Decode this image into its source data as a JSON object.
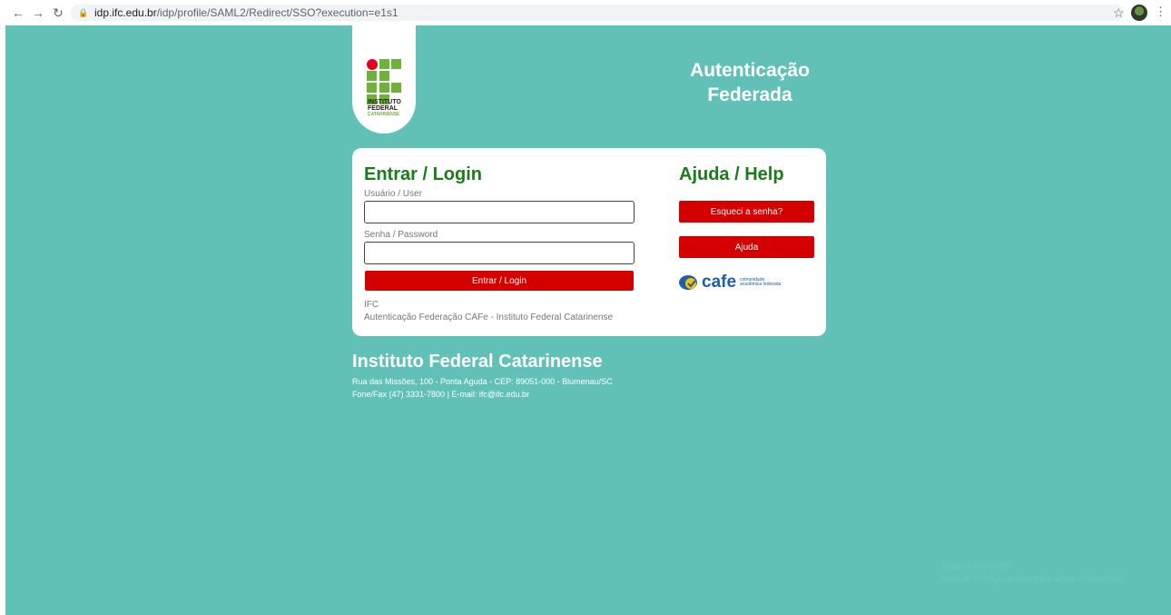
{
  "browser": {
    "url_host": "idp.ifc.edu.br",
    "url_path": "/idp/profile/SAML2/Redirect/SSO?execution=e1s1"
  },
  "logo": {
    "line1": "INSTITUTO",
    "line2": "FEDERAL",
    "line3": "CATARINENSE"
  },
  "header": {
    "title_line1": "Autenticação",
    "title_line2": "Federada"
  },
  "login": {
    "heading": "Entrar / Login",
    "user_label": "Usuário / User",
    "password_label": "Senha / Password",
    "user_value": "",
    "password_value": "",
    "submit_label": "Entrar / Login",
    "footer_line1": "IFC",
    "footer_line2": "Autenticação Federação CAFe - Instituto Federal Catarinense"
  },
  "help": {
    "heading": "Ajuda / Help",
    "forgot_label": "Esqueci a senha?",
    "help_label": "Ajuda",
    "cafe_word": "cafe",
    "cafe_tag_line1": "comunidade",
    "cafe_tag_line2": "acadêmica federada"
  },
  "institution": {
    "name": "Instituto Federal Catarinense",
    "address": "Rua das Missões, 100 - Ponta Aguda - CEP: 89051-000 - Blumenau/SC",
    "contact": "Fone/Fax (47) 3331-7800 | E-mail: ifc@ifc.edu.br"
  },
  "watermark": {
    "line1": "Ativar o Windows",
    "line2": "Acesse Configurações para ativar o Windows."
  },
  "colors": {
    "page_bg": "#61c1b7",
    "accent_red": "#d40000",
    "heading_green": "#1c7b1a"
  }
}
